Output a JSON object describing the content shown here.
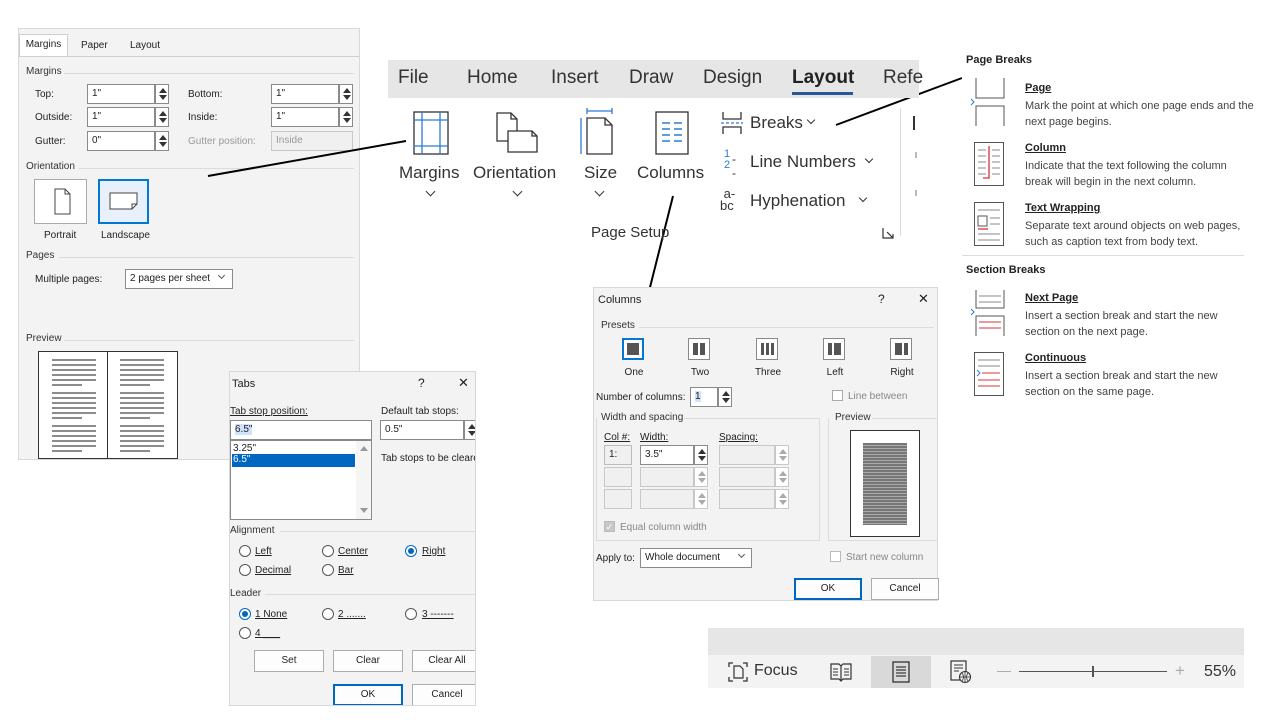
{
  "page_setup": {
    "tabs": [
      "Margins",
      "Paper",
      "Layout"
    ],
    "margins_group": "Margins",
    "top_label": "Top:",
    "top_value": "1\"",
    "bottom_label": "Bottom:",
    "bottom_value": "1\"",
    "outside_label": "Outside:",
    "outside_value": "1\"",
    "inside_label": "Inside:",
    "inside_value": "1\"",
    "gutter_label": "Gutter:",
    "gutter_value": "0\"",
    "gutter_pos_label": "Gutter position:",
    "gutter_pos_value": "Inside",
    "orientation_group": "Orientation",
    "portrait_label": "Portrait",
    "landscape_label": "Landscape",
    "pages_group": "Pages",
    "multiple_pages_label": "Multiple pages:",
    "multiple_pages_value": "2 pages per sheet",
    "preview_group": "Preview"
  },
  "ribbon": {
    "tabs": [
      "File",
      "Home",
      "Insert",
      "Draw",
      "Design",
      "Layout",
      "Refe"
    ],
    "active_tab": "Layout",
    "margins": "Margins",
    "orientation": "Orientation",
    "size": "Size",
    "columns": "Columns",
    "breaks": "Breaks",
    "line_numbers": "Line Numbers",
    "hyphenation": "Hyphenation",
    "group_label": "Page Setup",
    "accent": "#2b579a"
  },
  "breaks_menu": {
    "page_breaks_header": "Page Breaks",
    "section_breaks_header": "Section Breaks",
    "items": [
      {
        "title": "Page",
        "desc": "Mark the point at which one page ends and the next page begins."
      },
      {
        "title": "Column",
        "desc": "Indicate that the text following the column break will begin in the next column."
      },
      {
        "title": "Text Wrapping",
        "desc": "Separate text around objects on web pages, such as caption text from body text."
      },
      {
        "title": "Next Page",
        "desc": "Insert a section break and start the new section on the next page."
      },
      {
        "title": "Continuous",
        "desc": "Insert a section break and start the new section on the same page."
      }
    ]
  },
  "columns_dialog": {
    "title": "Columns",
    "help": "?",
    "close": "✕",
    "presets_label": "Presets",
    "presets": [
      "One",
      "Two",
      "Three",
      "Left",
      "Right"
    ],
    "num_columns_label": "Number of columns:",
    "num_columns_value": "1",
    "line_between": "Line between",
    "width_spacing": "Width and spacing",
    "col_header": "Col #:",
    "width_header": "Width:",
    "spacing_header": "Spacing:",
    "row1_col": "1:",
    "row1_width": "3.5\"",
    "equal_width": "Equal column width",
    "preview": "Preview",
    "apply_label": "Apply to:",
    "apply_value": "Whole document",
    "start_new_column": "Start new column",
    "ok": "OK",
    "cancel": "Cancel"
  },
  "tabs_dialog": {
    "title": "Tabs",
    "help": "?",
    "close": "✕",
    "tab_stop_label": "Tab stop position:",
    "tab_stop_value": "6.5\"",
    "default_label": "Default tab stops:",
    "default_value": "0.5\"",
    "list": [
      "3.25\"",
      "6.5\""
    ],
    "cleared_label": "Tab stops to be cleared:",
    "alignment": "Alignment",
    "left": "Left",
    "center": "Center",
    "right": "Right",
    "decimal": "Decimal",
    "bar": "Bar",
    "leader": "Leader",
    "leader1": "1 None",
    "leader2": "2 .......",
    "leader3": "3 -------",
    "leader4": "4 ___",
    "set": "Set",
    "clear": "Clear",
    "clear_all": "Clear All",
    "ok": "OK",
    "cancel": "Cancel"
  },
  "status_bar": {
    "focus": "Focus",
    "zoom": "55%",
    "zoom_minus": "—",
    "zoom_plus": "+"
  }
}
